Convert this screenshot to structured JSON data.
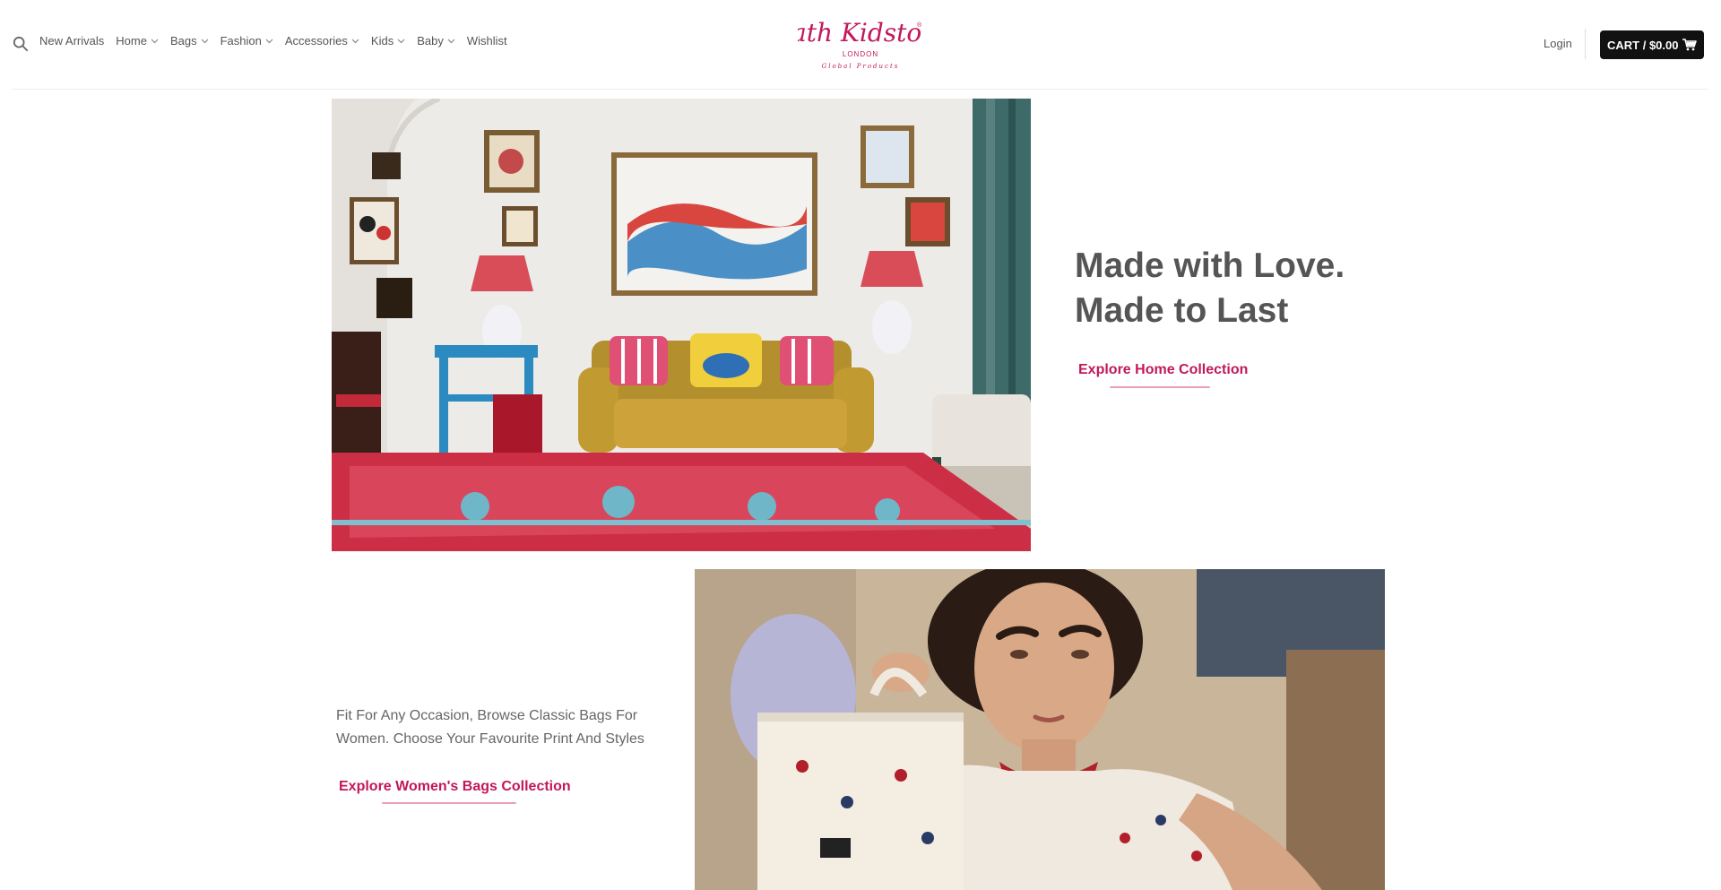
{
  "header": {
    "nav": [
      {
        "label": "New Arrivals",
        "has_dropdown": false
      },
      {
        "label": "Home",
        "has_dropdown": true
      },
      {
        "label": "Bags",
        "has_dropdown": true
      },
      {
        "label": "Fashion",
        "has_dropdown": true
      },
      {
        "label": "Accessories",
        "has_dropdown": true
      },
      {
        "label": "Kids",
        "has_dropdown": true
      },
      {
        "label": "Baby",
        "has_dropdown": true
      },
      {
        "label": "Wishlist",
        "has_dropdown": false
      }
    ],
    "logo": {
      "script": "Cath Kidston",
      "sub": "LONDON",
      "tag": "Global Products",
      "registered": "®"
    },
    "login_label": "Login",
    "cart_label": "CART / $0.00"
  },
  "hero_home": {
    "title_line1": "Made with Love.",
    "title_line2": "Made to Last",
    "cta_label": "Explore Home Collection"
  },
  "bags_section": {
    "description": "Fit For Any Occasion, Browse Classic Bags For Women. Choose Your Favourite Print And Styles",
    "cta_label": "Explore Women's Bags Collection"
  },
  "colors": {
    "accent": "#c2185b",
    "cart_bg": "#111111",
    "text": "#555555"
  }
}
